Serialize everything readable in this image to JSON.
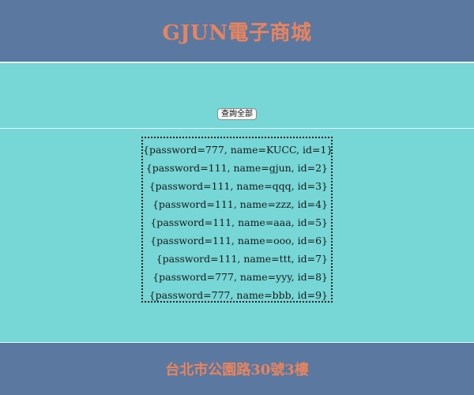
{
  "header": {
    "title": "GJUN電子商城"
  },
  "controls": {
    "query_all_label": "查詢全部"
  },
  "results": [
    "{password=777, name=KUCC, id=1}",
    "{password=111, name=gjun, id=2}",
    "{password=111, name=qqq, id=3}",
    "{password=111, name=zzz, id=4}",
    "{password=111, name=aaa, id=5}",
    "{password=111, name=ooo, id=6}",
    "{password=111, name=ttt, id=7}",
    "{password=777, name=yyy, id=8}",
    "{password=777, name=bbb, id=9}"
  ],
  "footer": {
    "address": "台北市公園路30號3樓"
  },
  "colors": {
    "header_bg": "#5b78a1",
    "page_bg": "#77d6d6",
    "title_text": "#e8845d"
  }
}
